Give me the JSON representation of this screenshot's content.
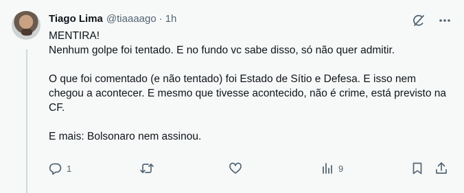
{
  "tweet": {
    "author": {
      "display_name": "Tiago Lima",
      "handle": "@tiaaaago",
      "separator": "·",
      "time": "1h"
    },
    "paragraphs": [
      "MENTIRA!\nNenhum golpe foi tentado. E no fundo vc sabe disso, só não quer admitir.",
      "O que foi comentado (e não tentado) foi Estado de Sítio e Defesa. E isso nem chegou a acontecer. E mesmo que tivesse acontecido, não é crime, está previsto na CF.",
      "E mais: Bolsonaro nem assinou."
    ],
    "actions": {
      "reply_count": "1",
      "repost_count": "",
      "like_count": "",
      "views_count": "9"
    }
  },
  "icons": {
    "grok": "grok-icon",
    "more": "more-icon",
    "reply": "reply-icon",
    "repost": "repost-icon",
    "like": "like-icon",
    "views": "views-icon",
    "bookmark": "bookmark-icon",
    "share": "share-icon"
  },
  "colors": {
    "background": "#f7f9f9",
    "text": "#0f1419",
    "secondary": "#536471",
    "thread_line": "#cfd9de"
  }
}
